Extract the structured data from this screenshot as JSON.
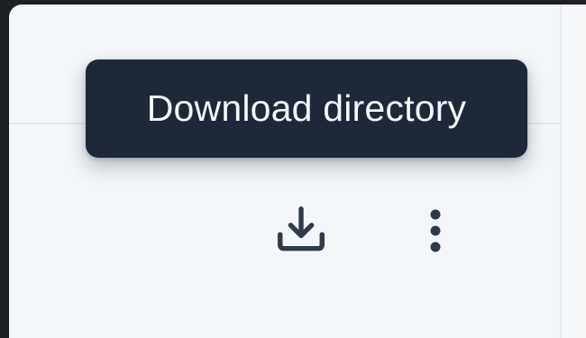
{
  "tooltip": {
    "text": "Download directory"
  },
  "actions": {
    "download_icon": "download-icon",
    "more_icon": "more-vertical-icon"
  },
  "colors": {
    "background": "#f4f7f9",
    "tooltip_bg": "#1e2838",
    "tooltip_text": "#f5f7fa",
    "icon": "#2f3a4a"
  }
}
